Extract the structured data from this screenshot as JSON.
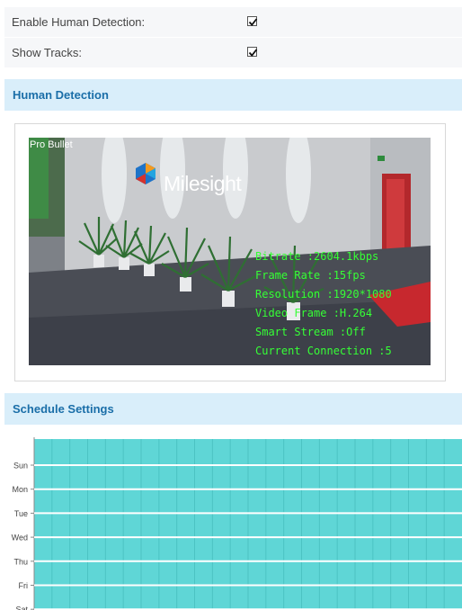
{
  "settings": {
    "enable_human_detection": {
      "label": "Enable Human Detection:",
      "checked": true
    },
    "show_tracks": {
      "label": "Show Tracks:",
      "checked": true
    }
  },
  "human_detection": {
    "title": "Human Detection",
    "video": {
      "camera_name": "Pro Bullet",
      "logo_text": "Milesight",
      "osd": [
        "Bitrate :2604.1kbps",
        "Frame Rate :15fps",
        "Resolution :1920*1080",
        "Video Frame :H.264",
        "Smart Stream :Off",
        "Current Connection :5"
      ]
    }
  },
  "schedule": {
    "title": "Schedule Settings",
    "days": [
      "Sun",
      "Mon",
      "Tue",
      "Wed",
      "Thu",
      "Fri",
      "Sat"
    ],
    "fill_color": "#5fd6d6"
  }
}
